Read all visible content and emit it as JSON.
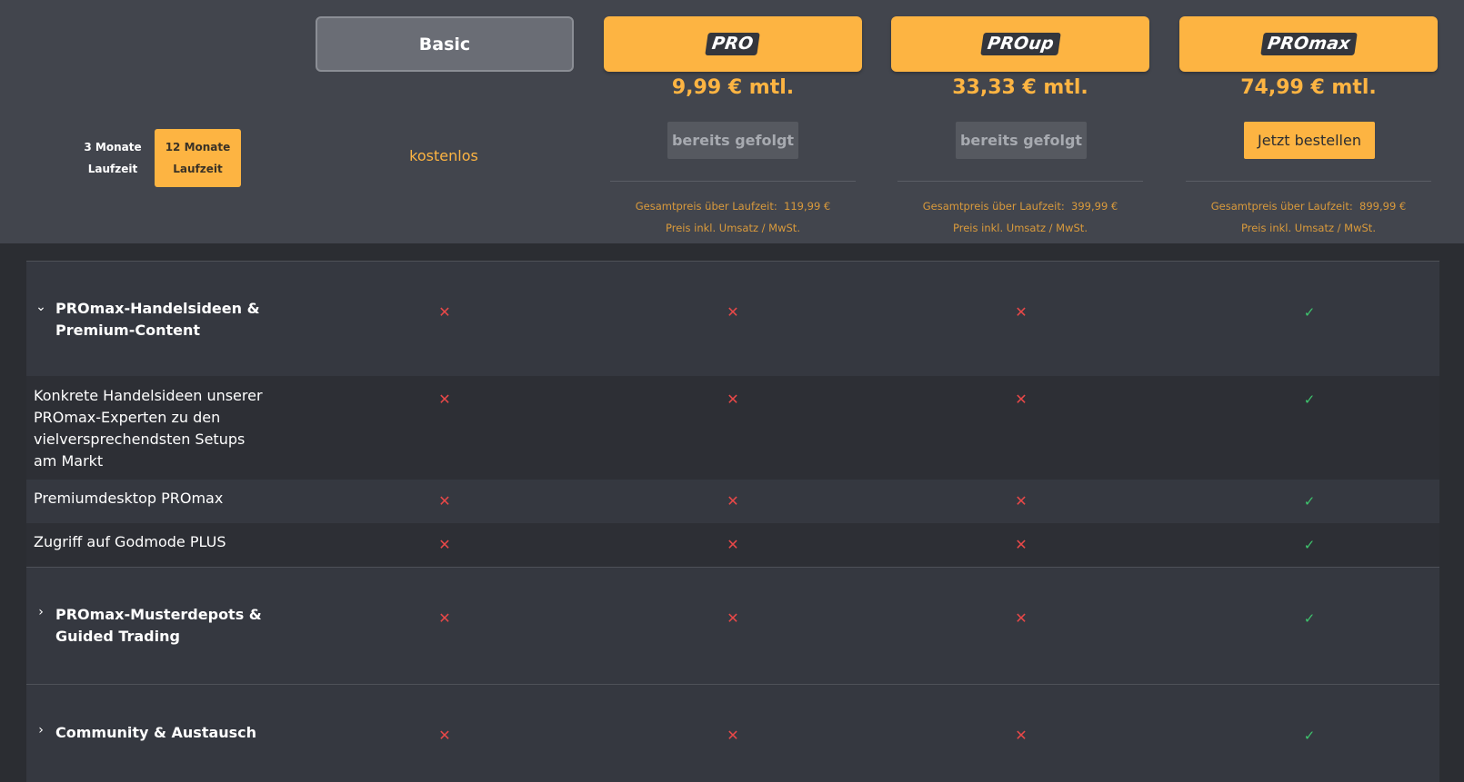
{
  "duration_toggle": {
    "option_3": "3 Monate Laufzeit",
    "option_12": "12 Monate Laufzeit",
    "selected": "12 Monate Laufzeit"
  },
  "plans": [
    {
      "name": "Basic",
      "price_text": "kostenlos"
    },
    {
      "name": "PRO",
      "price": "9,99 € mtl.",
      "action": "bereits gefolgt",
      "total_label": "Gesamtpreis über Laufzeit:",
      "total": "119,99 €",
      "tax_note": "Preis inkl. Umsatz / MwSt."
    },
    {
      "name": "PROup",
      "price": "33,33 € mtl.",
      "action": "bereits gefolgt",
      "total_label": "Gesamtpreis über Laufzeit:",
      "total": "399,99 €",
      "tax_note": "Preis inkl. Umsatz / MwSt."
    },
    {
      "name": "PROmax",
      "price": "74,99 € mtl.",
      "action": "Jetzt bestellen",
      "total_label": "Gesamtpreis über Laufzeit:",
      "total": "899,99 €",
      "tax_note": "Preis inkl. Umsatz / MwSt."
    }
  ],
  "sections": [
    {
      "title": "PROmax-Handelsideen & Premium-Content",
      "expanded": true,
      "availability": [
        false,
        false,
        false,
        true
      ],
      "features": [
        {
          "label": "Konkrete Handelsideen unserer PROmax-Experten zu den vielversprechendsten Setups am Markt",
          "availability": [
            false,
            false,
            false,
            true
          ]
        },
        {
          "label": "Premiumdesktop PROmax",
          "availability": [
            false,
            false,
            false,
            true
          ]
        },
        {
          "label": "Zugriff auf Godmode PLUS",
          "availability": [
            false,
            false,
            false,
            true
          ]
        }
      ]
    },
    {
      "title": "PROmax-Musterdepots & Guided Trading",
      "expanded": false,
      "availability": [
        false,
        false,
        false,
        true
      ]
    },
    {
      "title": "Community & Austausch",
      "expanded": false,
      "availability": [
        false,
        false,
        false,
        true
      ]
    }
  ],
  "icons": {
    "expanded": "chevron-down-icon",
    "collapsed": "chevron-right-icon",
    "no": "cross-icon",
    "yes": "check-icon"
  },
  "colors": {
    "accent": "#fdb442",
    "cross": "#e84848",
    "check": "#3ec46d"
  },
  "glyphs": {
    "chev_down": "⌄",
    "chev_right": "›",
    "cross": "✕",
    "check": "✓"
  }
}
